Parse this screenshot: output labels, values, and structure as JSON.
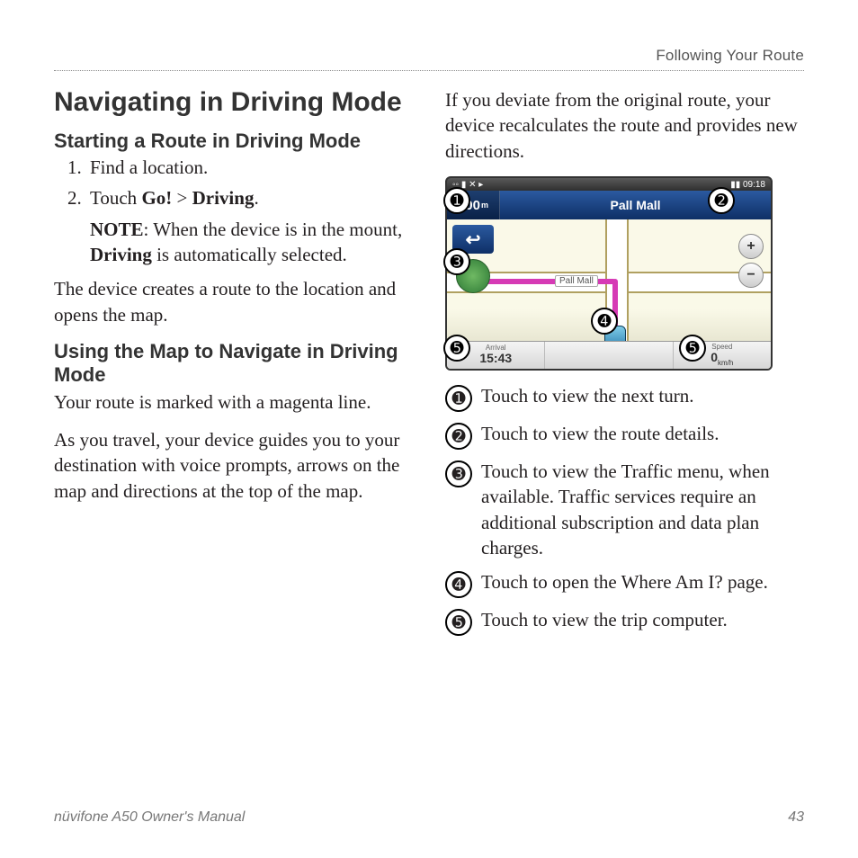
{
  "header": {
    "running_head": "Following Your Route"
  },
  "left": {
    "h1": "Navigating in Driving Mode",
    "sub1": "Starting a Route in Driving Mode",
    "step1": "Find a location.",
    "step2_pre": "Touch ",
    "step2_go": "Go!",
    "step2_gt": " > ",
    "step2_driving": "Driving",
    "step2_post": ".",
    "note_label": "NOTE",
    "note_colon": ": When the device is in the mount, ",
    "note_driving": "Driving",
    "note_rest": " is automatically selected.",
    "para_after_steps": "The device creates a route to the location and opens the map.",
    "sub2": "Using the Map to Navigate in Driving Mode",
    "para_magenta": "Your route is marked with a magenta line.",
    "para_travel": "As you travel, your device guides you to your destination with voice prompts, arrows on the map and directions at the top of the map."
  },
  "right": {
    "para_deviate": "If you deviate from the original route, your device recalculates the route and provides new directions.",
    "callouts": [
      {
        "n": "➊",
        "text": "Touch to view the next turn."
      },
      {
        "n": "➋",
        "text": "Touch to view the route details."
      },
      {
        "n": "➌",
        "text": "Touch to view the Traffic menu, when available. Traffic services require an additional subscription and data plan charges."
      },
      {
        "n": "➍",
        "text": "Touch to open the Where Am I? page."
      },
      {
        "n": "➎",
        "text": "Touch to view the trip computer."
      }
    ]
  },
  "device": {
    "status_left": "◦◦ ▮ ✕ ▸",
    "status_right": "▮▮ 09:18",
    "distance": "100",
    "distance_unit": "m",
    "destination": "Pall Mall",
    "road_label": "Pall Mall",
    "arrival_label": "Arrival",
    "arrival_value": "15:43",
    "speed_label": "Speed",
    "speed_value": "0",
    "speed_unit": "km/h",
    "callout_positions": {
      "c1": "➊",
      "c2": "➋",
      "c3": "➌",
      "c4": "➍",
      "c5a": "➎",
      "c5b": "➎"
    }
  },
  "footer": {
    "left": "nüvifone A50 Owner's Manual",
    "right": "43"
  }
}
